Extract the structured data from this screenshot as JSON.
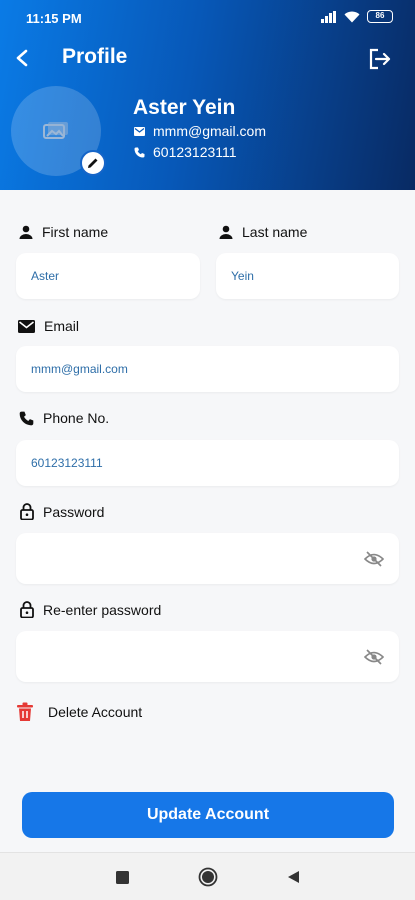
{
  "status_bar": {
    "time": "11:15 PM",
    "battery": "86"
  },
  "header": {
    "title": "Profile"
  },
  "user": {
    "name": "Aster Yein",
    "email": "mmm@gmail.com",
    "phone": "60123123111"
  },
  "form": {
    "first_name": {
      "label": "First name",
      "value": "Aster"
    },
    "last_name": {
      "label": "Last name",
      "value": "Yein"
    },
    "email": {
      "label": "Email",
      "value": "mmm@gmail.com"
    },
    "phone": {
      "label": "Phone No.",
      "value": "60123123111"
    },
    "password": {
      "label": "Password",
      "value": ""
    },
    "confirm_password": {
      "label": "Re-enter password",
      "value": ""
    }
  },
  "delete_label": "Delete Account",
  "update_label": "Update Account",
  "colors": {
    "primary": "#1677e8",
    "danger": "#e53935",
    "header_dark": "#082a63"
  },
  "icons": [
    "back-arrow-icon",
    "logout-icon",
    "image-placeholder-icon",
    "pencil-icon",
    "email-icon",
    "phone-icon",
    "person-icon",
    "lock-icon",
    "eye-off-icon",
    "trash-icon",
    "nav-square-icon",
    "nav-circle-icon",
    "nav-triangle-icon"
  ]
}
